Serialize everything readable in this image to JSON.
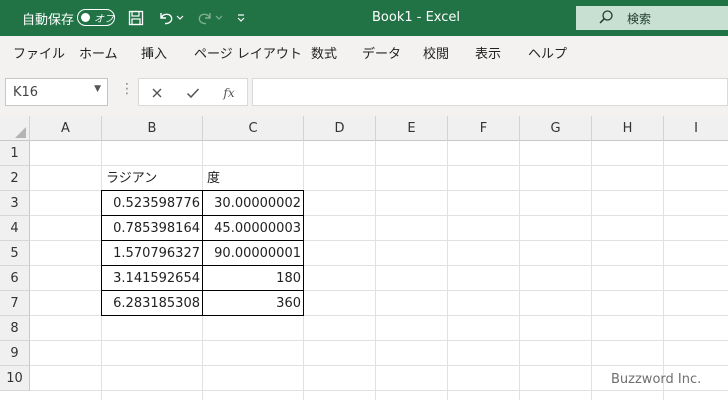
{
  "titlebar": {
    "autosave_label": "自動保存",
    "autosave_state": "オフ",
    "title": "Book1  -  Excel",
    "search_label": "検索"
  },
  "menu": {
    "items": [
      "ファイル",
      "ホーム",
      "挿入",
      "ページ レイアウト",
      "数式",
      "データ",
      "校閲",
      "表示",
      "ヘルプ"
    ]
  },
  "formula_bar": {
    "name_box": "K16",
    "fx_label": "fx",
    "value": ""
  },
  "grid": {
    "columns": [
      "A",
      "B",
      "C",
      "D",
      "E",
      "F",
      "G",
      "H",
      "I"
    ],
    "rows": [
      "1",
      "2",
      "3",
      "4",
      "5",
      "6",
      "7",
      "8",
      "9",
      "10"
    ],
    "header_B2": "ラジアン",
    "header_C2": "度",
    "data": [
      {
        "b": "0.523598776",
        "c": "30.00000002"
      },
      {
        "b": "0.785398164",
        "c": "45.00000003"
      },
      {
        "b": "1.570796327",
        "c": "90.00000001"
      },
      {
        "b": "3.141592654",
        "c": "180"
      },
      {
        "b": "6.283185308",
        "c": "360"
      }
    ]
  },
  "watermark": "Buzzword Inc.",
  "colors": {
    "titlebar_bg": "#217346",
    "search_bg": "#c8e0d1"
  }
}
